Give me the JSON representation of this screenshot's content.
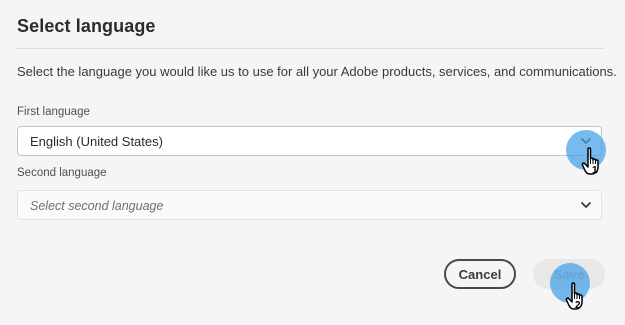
{
  "dialog": {
    "title": "Select language",
    "description": "Select the language you would like us to use for all your Adobe products, services, and communications."
  },
  "fields": {
    "first_language": {
      "label": "First language",
      "value": "English (United States)"
    },
    "second_language": {
      "label": "Second language",
      "placeholder": "Select second language"
    }
  },
  "actions": {
    "cancel_label": "Cancel",
    "save_label": "Save"
  },
  "steps": {
    "step1": "1",
    "step2": "2"
  },
  "icons": {
    "dropdown": "chevron-down-icon",
    "pointer": "hand-pointer-icon"
  },
  "colors": {
    "highlight": "#42a0e6",
    "background": "#f5f5f5",
    "save_disabled_bg": "#e8e8e8"
  }
}
